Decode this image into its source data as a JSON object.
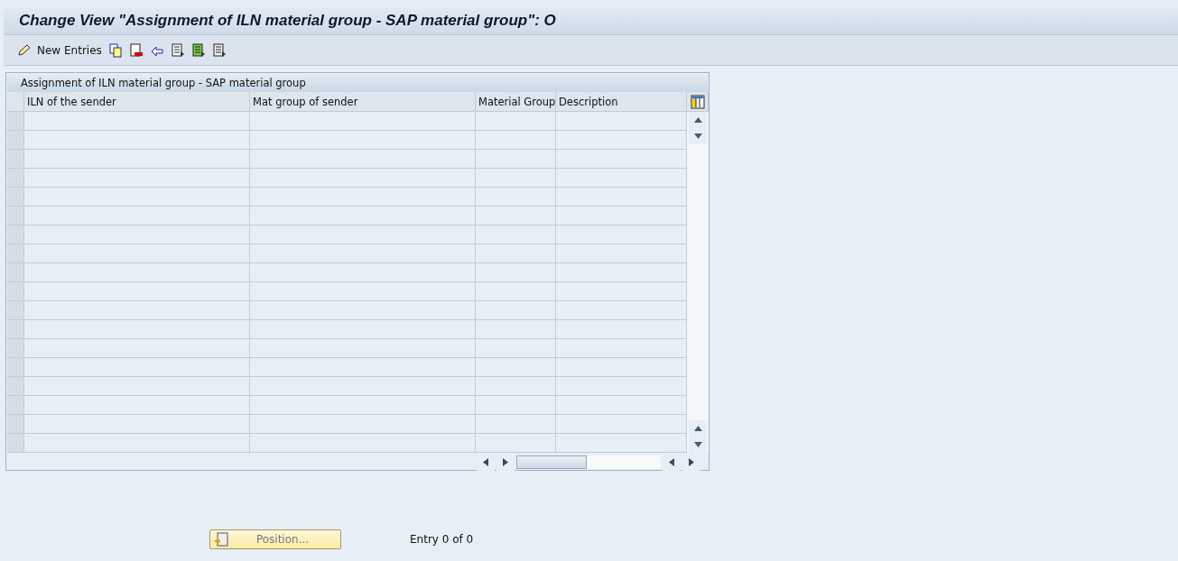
{
  "window": {
    "title": "Change View \"Assignment of ILN material group - SAP material group\": O"
  },
  "toolbar": {
    "new_entries": "New Entries"
  },
  "table": {
    "title": "Assignment of ILN material group - SAP material group",
    "columns": [
      "ILN of the sender",
      "Mat group of sender",
      "Material Group",
      "Description"
    ]
  },
  "footer": {
    "position_button": "Position...",
    "entry_count": "Entry 0 of 0"
  }
}
